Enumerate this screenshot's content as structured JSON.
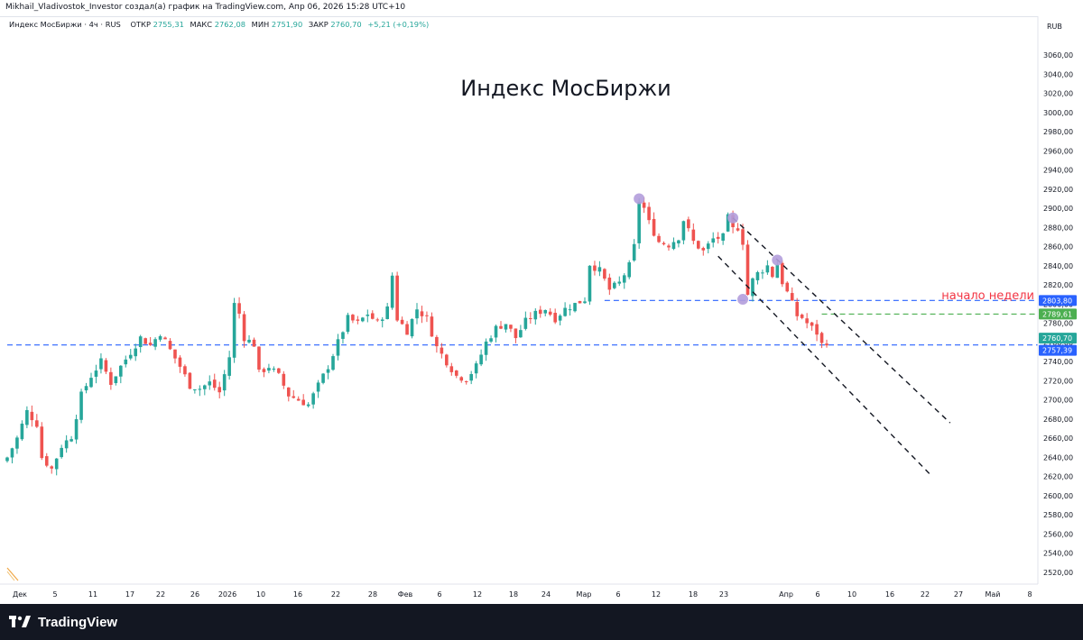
{
  "header": {
    "attribution": "Mikhail_Vladivostok_Investor создал(а) график на TradingView.com, Апр 06, 2026 15:28 UTC+10"
  },
  "legend": {
    "symbol": "Индекс МосБиржи · 4ч · RUS",
    "open_label": "ОТКР",
    "open_value": "2755,31",
    "high_label": "МАКС",
    "high_value": "2762,08",
    "low_label": "МИН",
    "low_value": "2751,90",
    "close_label": "ЗАКР",
    "close_value": "2760,70",
    "change": "+5,21 (+0,19%)"
  },
  "footer": {
    "brand": "TradingView",
    "logo_icon": "tradingview-logo-icon"
  },
  "colors": {
    "up": "#26a69a",
    "down": "#ef5350",
    "blue_line": "#2962ff",
    "green_line": "#4caf50",
    "text_red": "#f23645",
    "marker": "#b39ddb"
  },
  "chart_data": {
    "type": "candlestick",
    "title": "Индекс МосБиржи",
    "currency": "RUB",
    "ylim": [
      2505,
      3070
    ],
    "y_ticks": [
      "3060,00",
      "3040,00",
      "3020,00",
      "3000,00",
      "2980,00",
      "2960,00",
      "2940,00",
      "2920,00",
      "2900,00",
      "2880,00",
      "2860,00",
      "2840,00",
      "2820,00",
      "2800,00",
      "2780,00",
      "2760,00",
      "2740,00",
      "2720,00",
      "2700,00",
      "2680,00",
      "2660,00",
      "2640,00",
      "2620,00",
      "2600,00",
      "2580,00",
      "2560,00",
      "2540,00",
      "2520,00"
    ],
    "x_ticks": [
      "Дек",
      "5",
      "11",
      "17",
      "22",
      "26",
      "2026",
      "10",
      "16",
      "22",
      "28",
      "Фев",
      "6",
      "12",
      "18",
      "24",
      "Мар",
      "6",
      "12",
      "18",
      "23",
      "Апр",
      "6",
      "10",
      "16",
      "22",
      "27",
      "Май",
      "8"
    ],
    "price_labels": [
      {
        "value": 2803.8,
        "text": "2803,80",
        "color": "#2962ff"
      },
      {
        "value": 2789.61,
        "text": "2789,61",
        "color": "#4caf50"
      },
      {
        "value": 2760.7,
        "text": "2760,70",
        "color": "#26a69a"
      },
      {
        "value": 2757.39,
        "text": "2757,39",
        "color": "#2962ff"
      }
    ],
    "horizontal_lines": [
      {
        "value": 2803.8,
        "style": "dashed",
        "color": "#2962ff"
      },
      {
        "value": 2789.61,
        "style": "dashed",
        "color": "#4caf50"
      },
      {
        "value": 2757.39,
        "style": "dashed",
        "color": "#2962ff"
      }
    ],
    "annotation": "начало недели",
    "price_waypoints": [
      [
        0,
        2640
      ],
      [
        2,
        2660
      ],
      [
        4,
        2688
      ],
      [
        6,
        2675
      ],
      [
        7,
        2640
      ],
      [
        9,
        2628
      ],
      [
        11,
        2652
      ],
      [
        13,
        2662
      ],
      [
        15,
        2705
      ],
      [
        17,
        2725
      ],
      [
        19,
        2740
      ],
      [
        21,
        2718
      ],
      [
        23,
        2735
      ],
      [
        25,
        2750
      ],
      [
        27,
        2765
      ],
      [
        29,
        2757
      ],
      [
        31,
        2770
      ],
      [
        33,
        2752
      ],
      [
        35,
        2735
      ],
      [
        37,
        2715
      ],
      [
        39,
        2712
      ],
      [
        41,
        2718
      ],
      [
        43,
        2708
      ],
      [
        45,
        2745
      ],
      [
        46,
        2800
      ],
      [
        47,
        2790
      ],
      [
        48,
        2765
      ],
      [
        50,
        2758
      ],
      [
        51,
        2728
      ],
      [
        53,
        2735
      ],
      [
        55,
        2725
      ],
      [
        57,
        2705
      ],
      [
        59,
        2700
      ],
      [
        61,
        2695
      ],
      [
        63,
        2715
      ],
      [
        65,
        2735
      ],
      [
        67,
        2760
      ],
      [
        69,
        2785
      ],
      [
        71,
        2780
      ],
      [
        73,
        2790
      ],
      [
        75,
        2780
      ],
      [
        77,
        2795
      ],
      [
        78,
        2830
      ],
      [
        79,
        2785
      ],
      [
        81,
        2772
      ],
      [
        83,
        2795
      ],
      [
        85,
        2785
      ],
      [
        87,
        2755
      ],
      [
        89,
        2740
      ],
      [
        91,
        2725
      ],
      [
        93,
        2722
      ],
      [
        95,
        2735
      ],
      [
        97,
        2760
      ],
      [
        99,
        2775
      ],
      [
        101,
        2780
      ],
      [
        103,
        2765
      ],
      [
        105,
        2782
      ],
      [
        107,
        2790
      ],
      [
        109,
        2795
      ],
      [
        111,
        2785
      ],
      [
        113,
        2795
      ],
      [
        115,
        2800
      ],
      [
        117,
        2805
      ],
      [
        118,
        2842
      ],
      [
        120,
        2835
      ],
      [
        122,
        2815
      ],
      [
        124,
        2822
      ],
      [
        126,
        2840
      ],
      [
        127,
        2860
      ],
      [
        128,
        2908
      ],
      [
        129,
        2900
      ],
      [
        130,
        2885
      ],
      [
        132,
        2865
      ],
      [
        134,
        2862
      ],
      [
        136,
        2870
      ],
      [
        137,
        2888
      ],
      [
        139,
        2865
      ],
      [
        141,
        2855
      ],
      [
        143,
        2868
      ],
      [
        145,
        2870
      ],
      [
        146,
        2890
      ],
      [
        147,
        2878
      ],
      [
        148,
        2880
      ],
      [
        149,
        2865
      ],
      [
        150,
        2810
      ],
      [
        151,
        2825
      ],
      [
        152,
        2832
      ],
      [
        154,
        2840
      ],
      [
        155,
        2830
      ],
      [
        156,
        2842
      ],
      [
        157,
        2823
      ],
      [
        158,
        2812
      ],
      [
        159,
        2800
      ],
      [
        160,
        2788
      ],
      [
        161,
        2786
      ],
      [
        162,
        2780
      ],
      [
        163,
        2775
      ],
      [
        164,
        2770
      ],
      [
        165,
        2758
      ],
      [
        166,
        2760.7
      ]
    ],
    "markers": [
      {
        "index": 128,
        "value": 2910
      },
      {
        "index": 147,
        "value": 2890
      },
      {
        "index": 156,
        "value": 2846
      },
      {
        "index": 149,
        "value": 2805
      }
    ],
    "trend_lines": [
      {
        "from": [
          147,
          2890
        ],
        "to": [
          191,
          2676
        ]
      },
      {
        "from": [
          144,
          2850
        ],
        "to": [
          187,
          2622
        ]
      }
    ]
  }
}
